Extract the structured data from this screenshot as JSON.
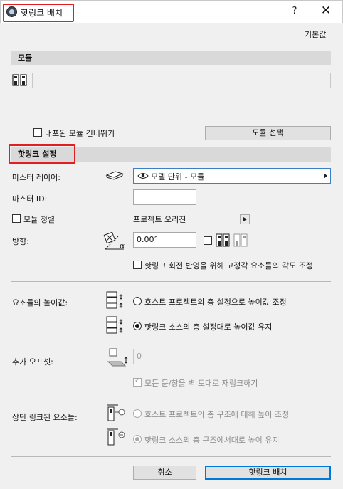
{
  "window": {
    "title": "핫링크 배치",
    "help_label": "?",
    "close_label": "✕"
  },
  "defaults_label": "기본값",
  "module_section": {
    "title": "모듈",
    "skip_nested_label": "내포된 모듈 건너뛰기",
    "select_module_button": "모듈 선택"
  },
  "hotlink_settings": {
    "title": "핫링크 설정",
    "master_layer_label": "마스터 레이어:",
    "master_layer_value": "모델 단위 - 모듈",
    "master_id_label": "마스터 ID:",
    "master_id_value": "",
    "align_module_label": "모듈 정렬",
    "project_origin_label": "프로젝트 오리진",
    "orientation_label": "방향:",
    "orientation_value": "0.00°",
    "adjust_angle_label": "핫링크 회전 반영을 위해 고정각 요소들의 각도 조정"
  },
  "elevation": {
    "label": "요소들의 높이값:",
    "option_host": "호스트 프로젝트의 층 설정으로 높이값 조정",
    "option_source": "핫링크 소스의 층 설정대로 높이값 유지",
    "selected": "source"
  },
  "offset": {
    "label": "추가 오프셋:",
    "value": "0",
    "relink_label": "모든 문/창을 벽 토대로 재링크하기"
  },
  "top_linked": {
    "label": "상단 링크된 요소들:",
    "option_host": "호스트 프로젝트의 층 구조에 대해 높이 조정",
    "option_source": "핫링크 소스의 층 구조에서대로 높이 유지"
  },
  "footer": {
    "cancel_button": "취소",
    "place_button": "핫링크 배치"
  }
}
